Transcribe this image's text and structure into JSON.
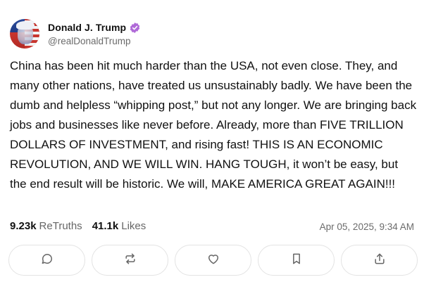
{
  "author": {
    "display_name": "Donald J. Trump",
    "handle": "@realDonaldTrump",
    "verified": true,
    "verified_color": "#b06ad8",
    "avatar_icon": "avatar-flag-portrait"
  },
  "post": {
    "text": "China has been hit much harder than the USA, not even close. They, and many other nations, have treated us unsustainably badly. We have been the dumb and helpless “whipping post,” but not any longer. We are bringing back jobs and businesses like never before. Already, more than FIVE TRILLION DOLLARS OF INVESTMENT, and rising fast! THIS IS AN ECONOMIC REVOLUTION, AND WE WILL WIN. HANG TOUGH, it won’t be easy, but the end result will be historic. We will, MAKE AMERICA GREAT AGAIN!!!"
  },
  "stats": {
    "retruths_count": "9.23k",
    "retruths_label": "ReTruths",
    "likes_count": "41.1k",
    "likes_label": "Likes"
  },
  "timestamp": "Apr 05, 2025, 9:34 AM",
  "actions": [
    {
      "name": "reply",
      "icon": "comment-icon"
    },
    {
      "name": "retruth",
      "icon": "repost-icon"
    },
    {
      "name": "like",
      "icon": "heart-icon"
    },
    {
      "name": "bookmark",
      "icon": "bookmark-icon"
    },
    {
      "name": "share",
      "icon": "share-icon"
    }
  ]
}
